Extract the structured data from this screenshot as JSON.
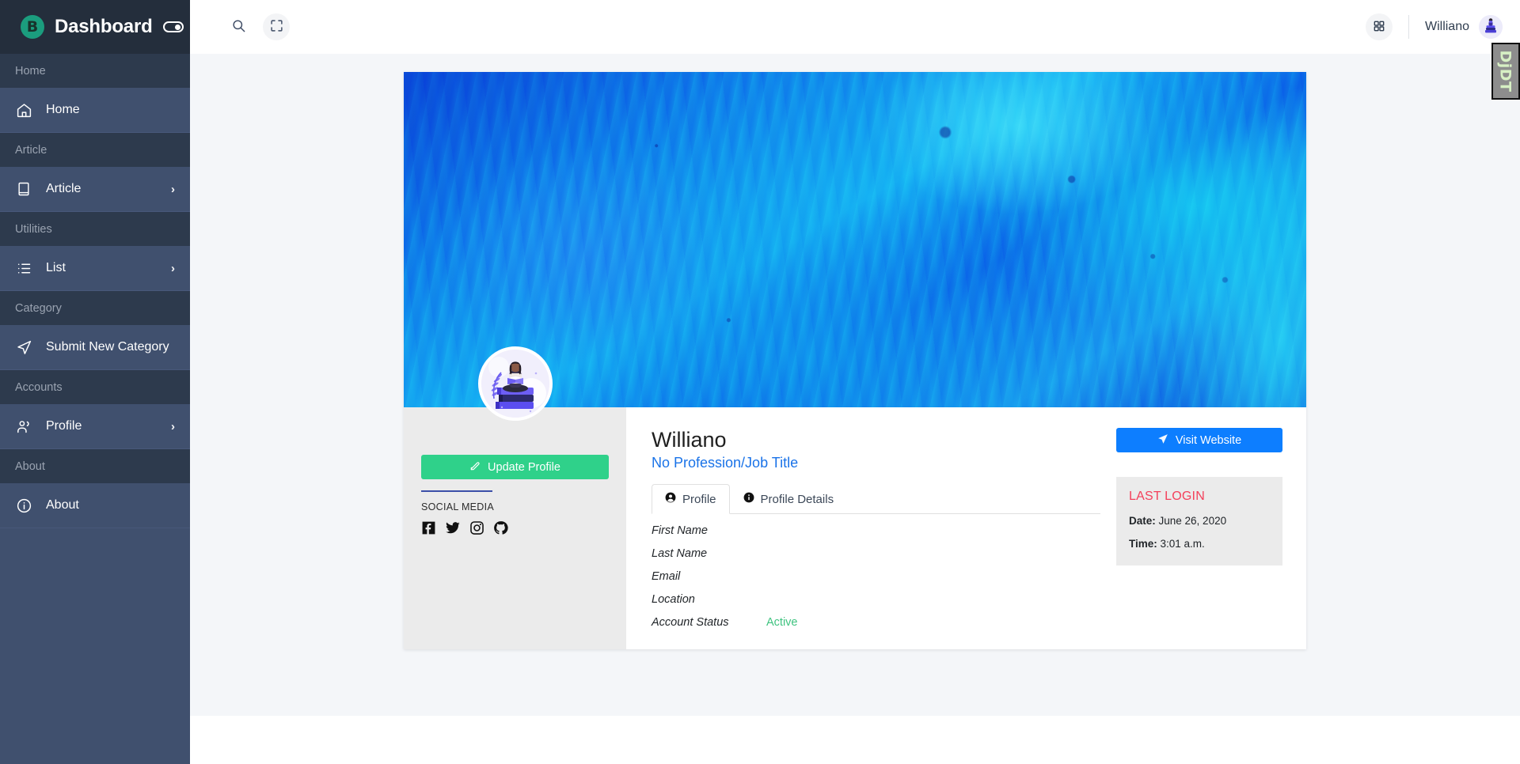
{
  "sidebar": {
    "brand": {
      "logo_letter": "B",
      "title": "Dashboard",
      "toggle_icon": "toggle-switch-icon"
    },
    "groups": [
      {
        "section": "Home",
        "item": {
          "label": "Home",
          "icon": "home-icon",
          "chevron": false
        }
      },
      {
        "section": "Article",
        "item": {
          "label": "Article",
          "icon": "book-icon",
          "chevron": true
        }
      },
      {
        "section": "Utilities",
        "item": {
          "label": "List",
          "icon": "list-icon",
          "chevron": true
        }
      },
      {
        "section": "Category",
        "item": {
          "label": "Submit New Category",
          "icon": "paper-plane-icon",
          "chevron": false
        }
      },
      {
        "section": "Accounts",
        "item": {
          "label": "Profile",
          "icon": "users-icon",
          "chevron": true
        }
      },
      {
        "section": "About",
        "item": {
          "label": "About",
          "icon": "info-circle-icon",
          "chevron": false
        }
      }
    ],
    "chevron_glyph": "›"
  },
  "topbar": {
    "search_icon": "search-icon",
    "fullscreen_icon": "fullscreen-icon",
    "grid_icon": "grid-apps-icon",
    "user_name": "Williano",
    "avatar": "user-avatar-illustration"
  },
  "profile": {
    "banner_alt": "blue-marble-paint-banner",
    "avatar_alt": "woman-reading-on-books-illustration",
    "update_button": "Update Profile",
    "update_button_icon": "edit-pencil-icon",
    "social_title": "SOCIAL MEDIA",
    "social": [
      {
        "name": "facebook-icon",
        "label": "Facebook"
      },
      {
        "name": "twitter-icon",
        "label": "Twitter"
      },
      {
        "name": "instagram-icon",
        "label": "Instagram"
      },
      {
        "name": "github-icon",
        "label": "GitHub"
      }
    ],
    "name": "Williano",
    "job_title": "No Profession/Job Title",
    "tabs": [
      {
        "label": "Profile",
        "icon": "user-circle-icon",
        "active": true
      },
      {
        "label": "Profile Details",
        "icon": "info-circle-icon",
        "active": false
      }
    ],
    "fields": [
      {
        "label": "First Name",
        "value": ""
      },
      {
        "label": "Last Name",
        "value": ""
      },
      {
        "label": "Email",
        "value": ""
      },
      {
        "label": "Location",
        "value": ""
      },
      {
        "label": "Account Status",
        "value": "Active"
      }
    ],
    "visit_button": "Visit Website",
    "visit_button_icon": "paper-plane-icon",
    "last_login": {
      "title": "LAST LOGIN",
      "date_label": "Date:",
      "date_value": " June 26, 2020",
      "time_label": "Time:",
      "time_value": " 3:01 a.m."
    }
  },
  "debug_toolbar": {
    "label": "DjDT"
  },
  "colors": {
    "sidebar_bg": "#40506e",
    "sidebar_section_bg": "#2d3a4d",
    "brand_bg": "#242e3c",
    "brand_accent": "#1b9d7e",
    "content_bg": "#f4f6f9",
    "update_green": "#2fd18a",
    "visit_blue": "#0d7eff",
    "job_title_blue": "#1a73e8",
    "last_login_red": "#f4405b",
    "active_green": "#3fc380",
    "panel_gray": "#ebebeb"
  }
}
